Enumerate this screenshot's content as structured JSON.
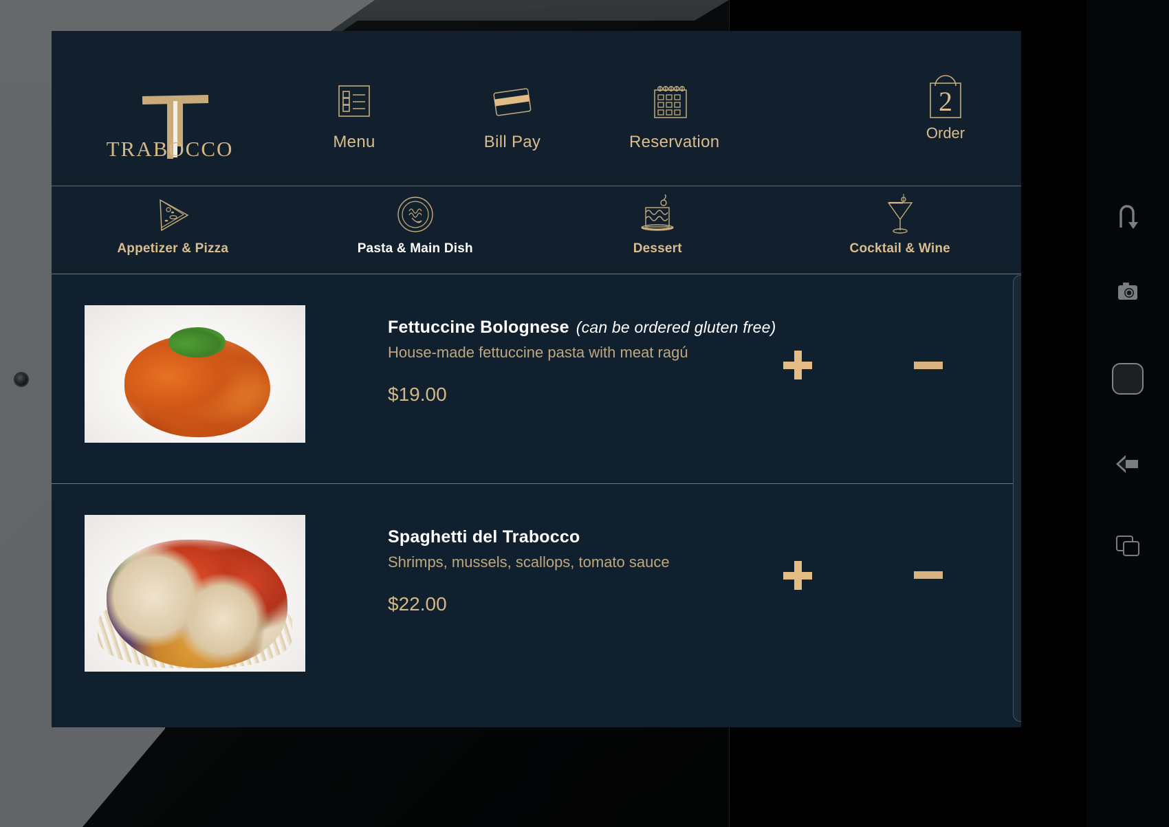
{
  "brand": {
    "name": "TRABOCCO",
    "logo_icon": "trabocco-t-mark",
    "gold": "#d3b786",
    "navy": "#12202e"
  },
  "topnav": {
    "items": [
      {
        "label": "Menu",
        "icon": "checklist-icon"
      },
      {
        "label": "Bill Pay",
        "icon": "credit-card-icon"
      },
      {
        "label": "Reservation",
        "icon": "calendar-icon"
      }
    ]
  },
  "order": {
    "label": "Order",
    "count": "2",
    "icon": "shopping-bag-icon"
  },
  "tabs": {
    "items": [
      {
        "label": "Appetizer & Pizza",
        "icon": "pizza-slice-icon",
        "active": false
      },
      {
        "label": "Pasta & Main Dish",
        "icon": "pasta-bowl-icon",
        "active": true
      },
      {
        "label": "Dessert",
        "icon": "cake-icon",
        "active": false
      },
      {
        "label": "Cocktail & Wine",
        "icon": "martini-glass-icon",
        "active": false
      }
    ]
  },
  "menu": {
    "items": [
      {
        "name": "Fettuccine Bolognese",
        "note": "(can be ordered gluten free)",
        "description": "House-made fettuccine pasta with meat ragú",
        "price": "$19.00",
        "image": "fettuccine-bolognese-photo",
        "add_label": "+",
        "remove_label": "−"
      },
      {
        "name": "Spaghetti del Trabocco",
        "note": "",
        "description": "Shrimps, mussels, scallops, tomato sauce",
        "price": "$22.00",
        "image": "spaghetti-del-trabocco-photo",
        "add_label": "+",
        "remove_label": "−"
      }
    ]
  },
  "device_nav": {
    "items": [
      {
        "icon": "rotate-icon"
      },
      {
        "icon": "screenshot-camera-icon"
      },
      {
        "icon": "home-icon"
      },
      {
        "icon": "back-icon"
      },
      {
        "icon": "recent-apps-icon"
      }
    ]
  }
}
